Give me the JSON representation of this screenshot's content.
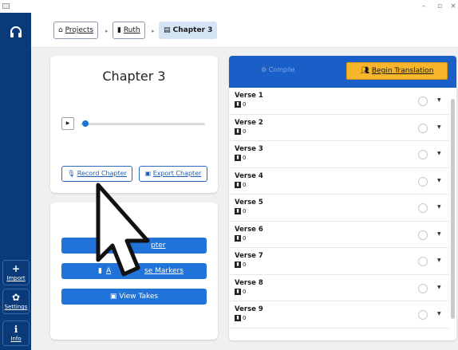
{
  "window": {
    "minimize": "–",
    "restore": "▫",
    "close": "×"
  },
  "rail": {
    "logo_icon": "headphones-icon",
    "buttons": [
      {
        "icon": "plus-icon",
        "glyph": "+",
        "label": "Import"
      },
      {
        "icon": "gear-icon",
        "glyph": "✿",
        "label": "Settings"
      },
      {
        "icon": "info-icon",
        "glyph": "ℹ",
        "label": "Info"
      }
    ]
  },
  "breadcrumb": {
    "items": [
      {
        "icon": "home-icon",
        "glyph": "⌂",
        "label": "Projects"
      },
      {
        "icon": "book-icon",
        "glyph": "▮",
        "label": "Ruth"
      },
      {
        "icon": "document-icon",
        "glyph": "▤",
        "label": "Chapter 3"
      }
    ]
  },
  "chapter_card": {
    "title": "Chapter 3",
    "record_label": "Record Chapter",
    "export_label": "Export Chapter"
  },
  "actions_card": {
    "edit_label": "Edit Chapter",
    "edit_visible_label": "pter",
    "markers_label": "Add Verse Markers",
    "markers_visible_a": "A",
    "markers_visible_b": "se Markers",
    "takes_label": "View Takes"
  },
  "verse_panel": {
    "compile_label": "Compile",
    "begin_label": "Begin Translation",
    "verses": [
      {
        "name": "Verse 1",
        "count": "0"
      },
      {
        "name": "Verse 2",
        "count": "0"
      },
      {
        "name": "Verse 3",
        "count": "0"
      },
      {
        "name": "Verse 4",
        "count": "0"
      },
      {
        "name": "Verse 5",
        "count": "0"
      },
      {
        "name": "Verse 6",
        "count": "0"
      },
      {
        "name": "Verse 7",
        "count": "0"
      },
      {
        "name": "Verse 8",
        "count": "0"
      },
      {
        "name": "Verse 9",
        "count": "0"
      }
    ]
  },
  "colors": {
    "rail": "#0a3a78",
    "primary": "#1f73d9",
    "header_blue": "#1a5fc7",
    "accent_orange": "#f7b52b"
  }
}
